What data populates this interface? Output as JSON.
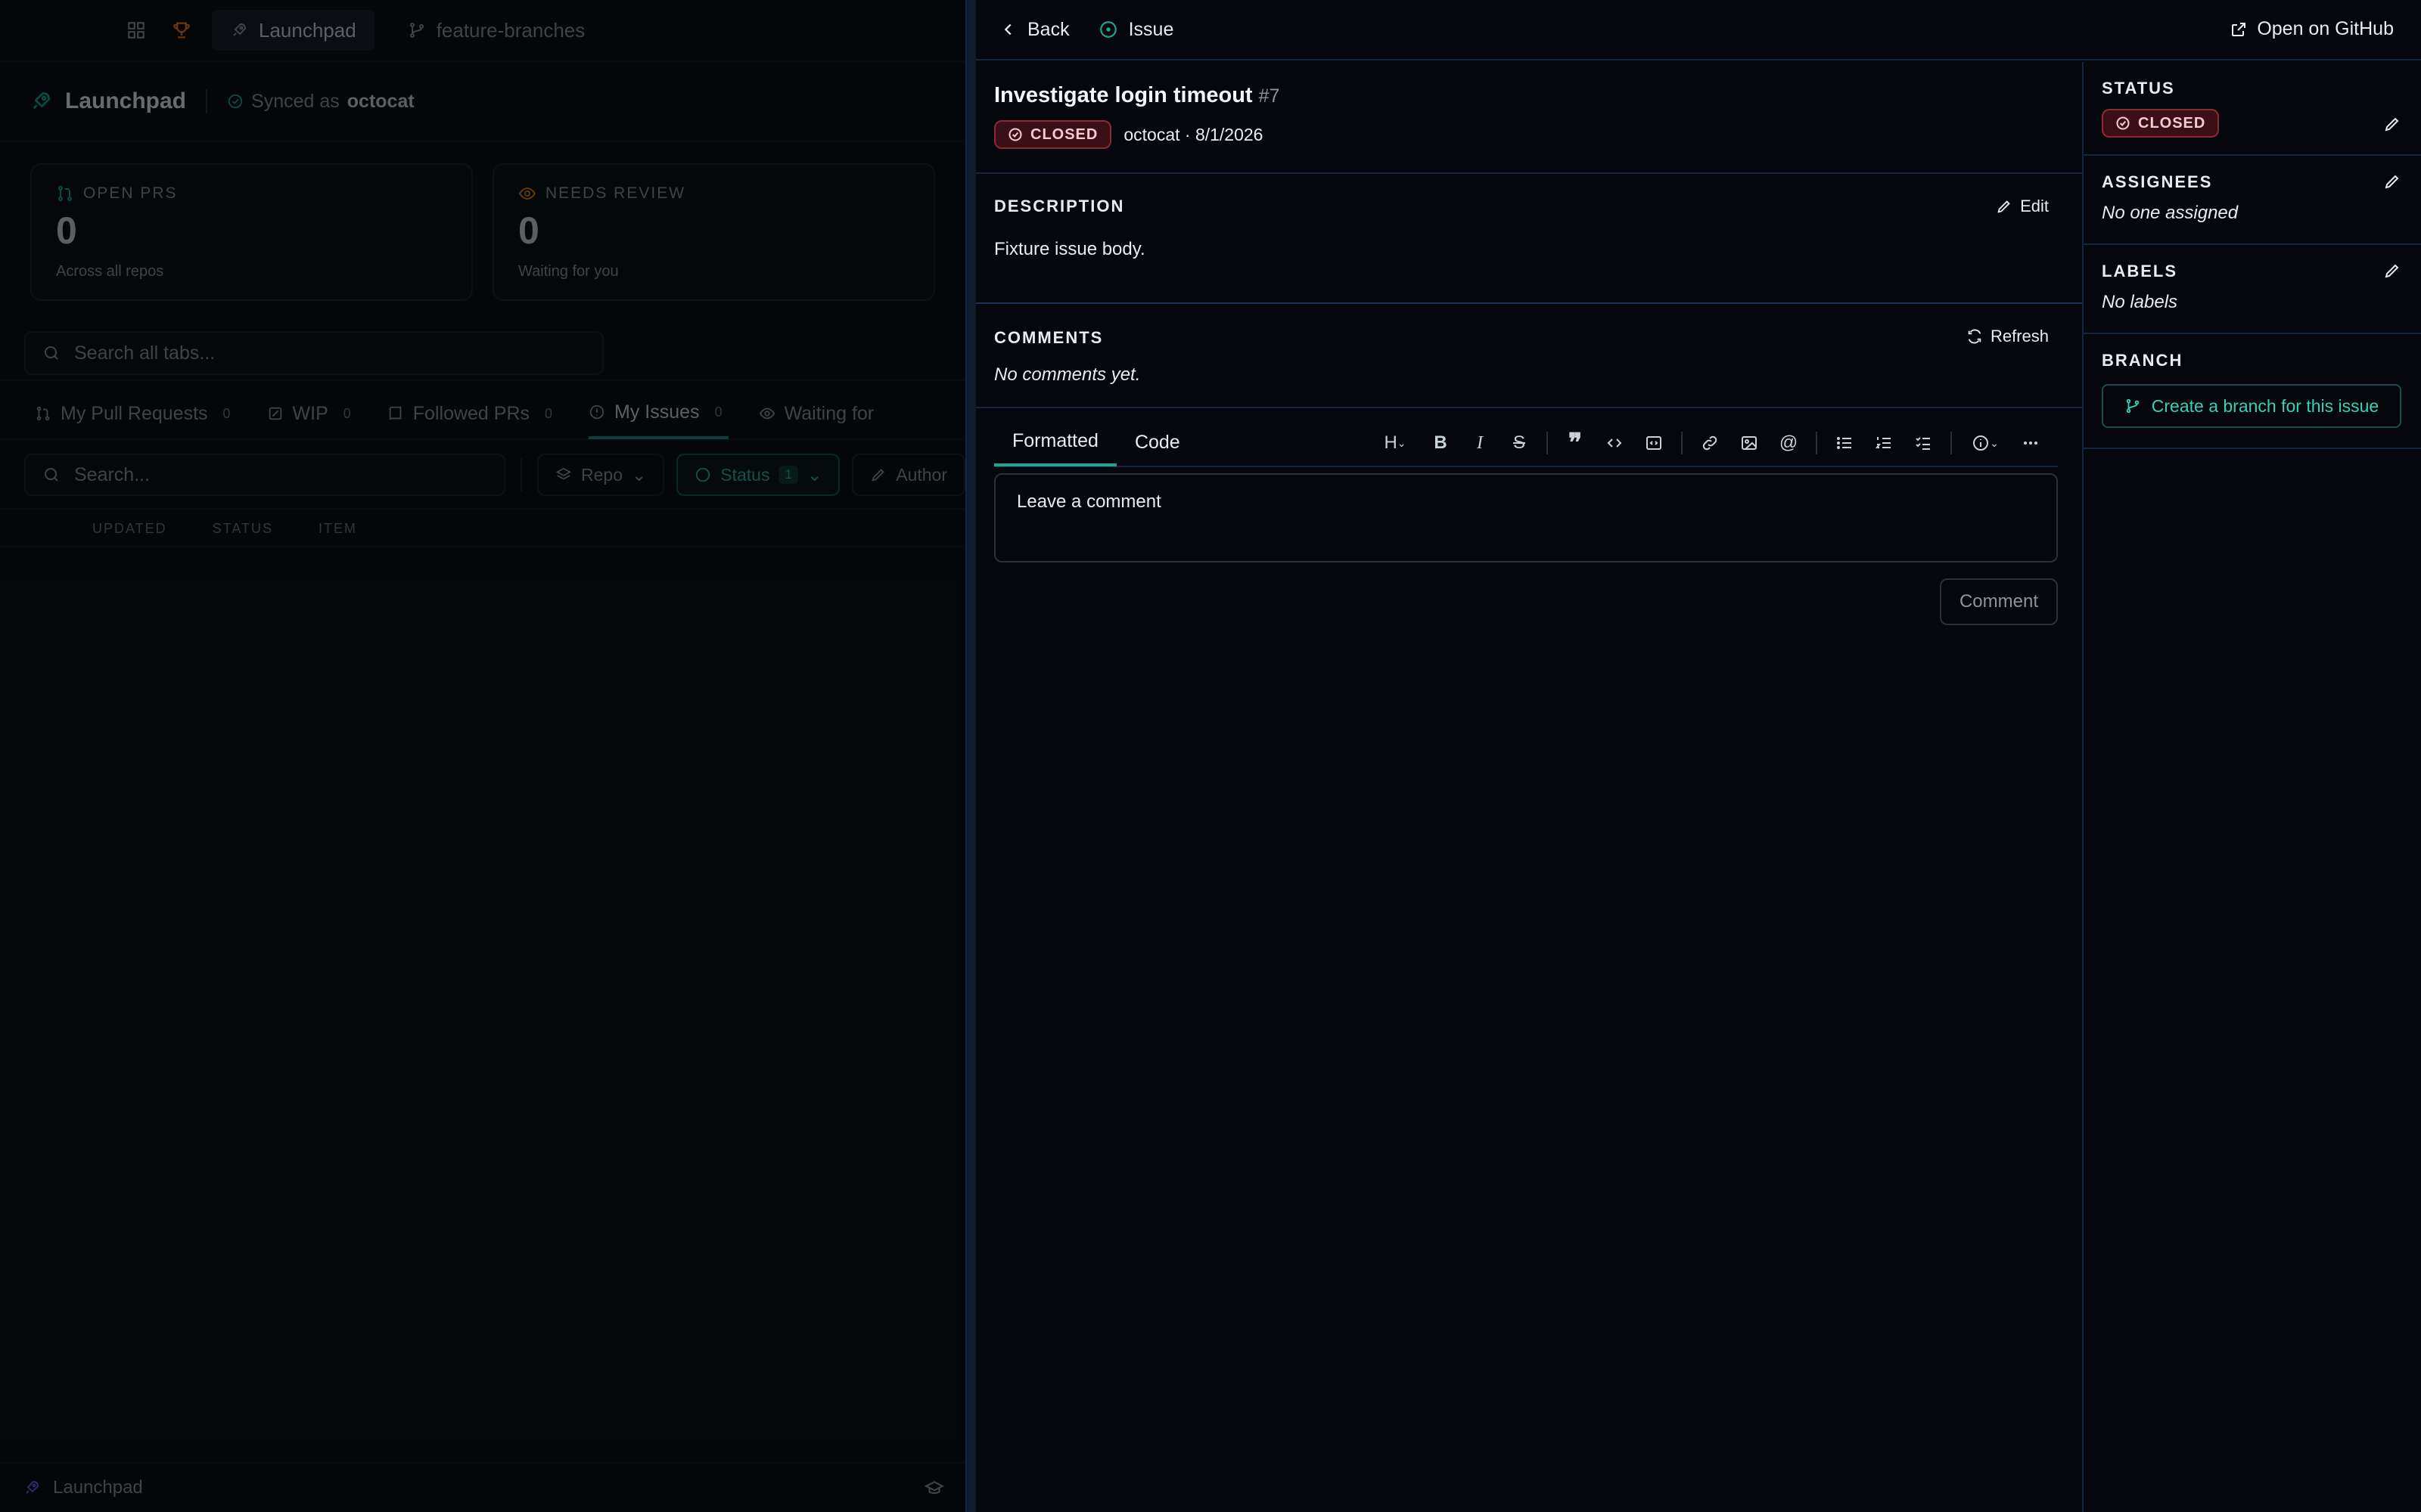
{
  "left": {
    "tabs": [
      "Launchpad",
      "feature-branches"
    ],
    "app_title": "Launchpad",
    "synced_prefix": "Synced as",
    "synced_user": "octocat",
    "stats": [
      {
        "label": "OPEN PRS",
        "value": "0",
        "sub": "Across all repos",
        "icon": "pull-request-icon"
      },
      {
        "label": "NEEDS REVIEW",
        "value": "0",
        "sub": "Waiting for you",
        "icon": "eye-icon"
      }
    ],
    "search_all_placeholder": "Search all tabs...",
    "subtabs": [
      {
        "label": "My Pull Requests",
        "count": "0"
      },
      {
        "label": "WIP",
        "count": "0"
      },
      {
        "label": "Followed PRs",
        "count": "0"
      },
      {
        "label": "My Issues",
        "count": "0"
      },
      {
        "label": "Waiting for",
        "count": ""
      }
    ],
    "search_placeholder": "Search...",
    "filters": {
      "repo": "Repo",
      "status": "Status",
      "status_count": "1",
      "author": "Author"
    },
    "columns": [
      "UPDATED",
      "STATUS",
      "ITEM"
    ],
    "footer_label": "Launchpad"
  },
  "panel": {
    "back_label": "Back",
    "kind_label": "Issue",
    "open_github": "Open on GitHub",
    "issue_title": "Investigate login timeout",
    "issue_number": "#7",
    "status_badge": "CLOSED",
    "meta": "octocat · 8/1/2026",
    "description_label": "DESCRIPTION",
    "edit_label": "Edit",
    "description_body": "Fixture issue body.",
    "comments_label": "COMMENTS",
    "refresh_label": "Refresh",
    "no_comments": "No comments yet.",
    "editor_tabs": [
      "Formatted",
      "Code"
    ],
    "comment_placeholder": "Leave a comment",
    "comment_button": "Comment"
  },
  "sidebar": {
    "status_label": "STATUS",
    "status_value": "CLOSED",
    "assignees_label": "ASSIGNEES",
    "assignees_value": "No one assigned",
    "labels_label": "LABELS",
    "labels_value": "No labels",
    "branch_label": "BRANCH",
    "branch_button": "Create a branch for this issue"
  },
  "colors": {
    "accent": "#1aa690",
    "closed": "#8a2b33",
    "background": "#05070c"
  }
}
